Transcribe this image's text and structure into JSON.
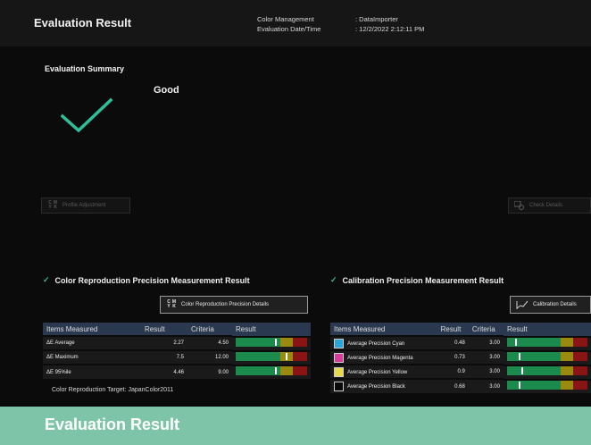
{
  "window": {
    "title": "Evaluation Result"
  },
  "meta": {
    "color_management_label": "Color Management",
    "color_management_value": ": DataImporter",
    "datetime_label": "Evaluation Date/Time",
    "datetime_value": ": 12/2/2022 2:12:11 PM"
  },
  "summary": {
    "title": "Evaluation Summary",
    "status": "Good",
    "icon": "checkmark-icon",
    "status_color": "#2fbf98"
  },
  "buttons": {
    "profile_adjustment": "Profile Adjustment",
    "check_details": "Check Details",
    "color_repro_details": "Color Reproduction Precision Details",
    "calibration_details": "Calibration Details"
  },
  "color_reproduction": {
    "title": "Color Reproduction Precision Measurement Result",
    "headers": [
      "Items Measured",
      "Result",
      "Criteria",
      "Result"
    ],
    "rows": [
      {
        "item": "ΔE Average",
        "result": "2.27",
        "criteria": "4.50",
        "level": 0.55
      },
      {
        "item": "ΔE Maximum",
        "result": "7.5",
        "criteria": "12.00",
        "level": 0.7
      },
      {
        "item": "ΔE 95%ile",
        "result": "4.46",
        "criteria": "9.00",
        "level": 0.55
      }
    ],
    "target": "Color Reproduction Target: JapanColor2011"
  },
  "calibration": {
    "title": "Calibration Precision Measurement Result",
    "headers": [
      "Items Measured",
      "Result",
      "Criteria",
      "Result"
    ],
    "rows": [
      {
        "item": "Average Precision Cyan",
        "result": "0.48",
        "criteria": "3.00",
        "color": "#2aa7d8",
        "level": 0.1
      },
      {
        "item": "Average Precision Magenta",
        "result": "0.73",
        "criteria": "3.00",
        "color": "#d63c9c",
        "level": 0.15
      },
      {
        "item": "Average Precision Yellow",
        "result": "0.9",
        "criteria": "3.00",
        "color": "#e8d94a",
        "level": 0.18
      },
      {
        "item": "Average Precision Black",
        "result": "0.68",
        "criteria": "3.00",
        "color": "#0a0a0a",
        "level": 0.14
      }
    ]
  },
  "caption": {
    "text": "Evaluation Result"
  },
  "colors": {
    "accent": "#2fbf98",
    "caption_bg": "#7ec4a9",
    "header_bg": "#2a3950"
  }
}
